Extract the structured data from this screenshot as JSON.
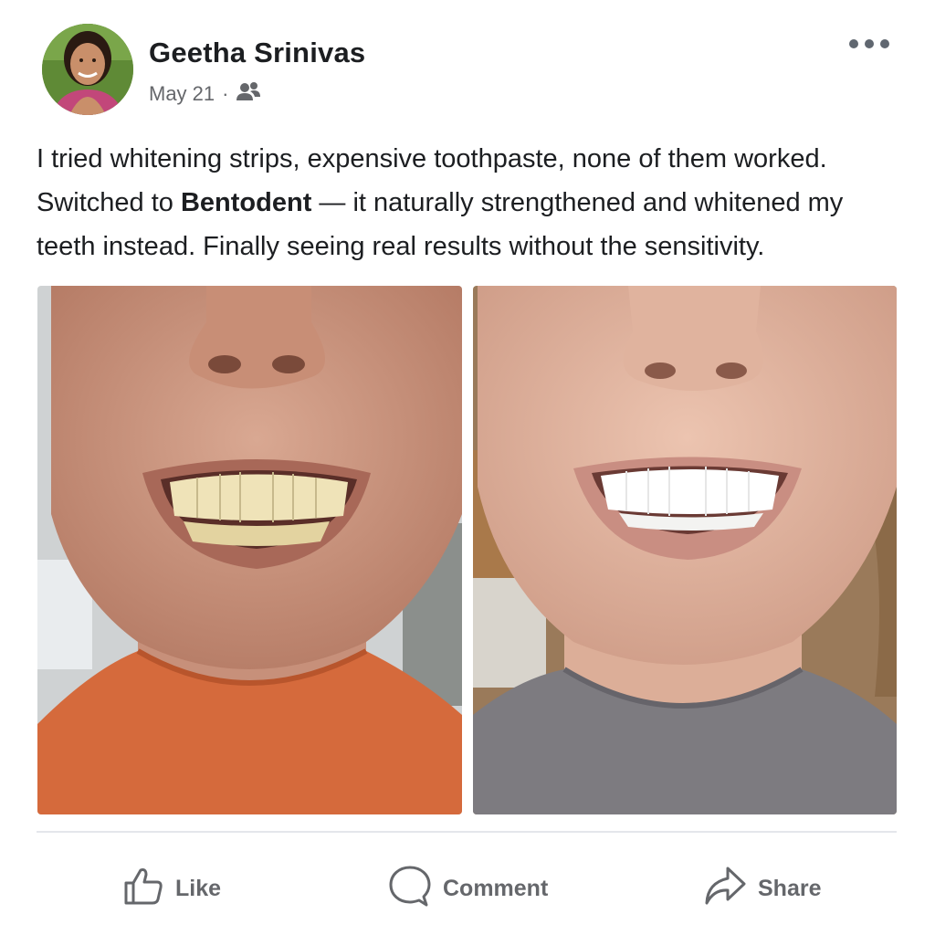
{
  "post": {
    "author": "Geetha Srinivas",
    "date": "May 21",
    "separator": "·",
    "audience_icon": "friends-icon",
    "text_part1": "I tried whitening strips, expensive toothpaste, none of them worked. Switched to ",
    "brand": "Bentodent",
    "text_part2": " — it naturally strengthened and whitened my teeth instead. Finally seeing real results without the sensitivity.",
    "images": [
      "before-photo",
      "after-photo"
    ]
  },
  "actions": {
    "like": "Like",
    "comment": "Comment",
    "share": "Share"
  },
  "colors": {
    "text": "#1c1e21",
    "secondary": "#65676b",
    "divider": "#e4e6eb"
  }
}
